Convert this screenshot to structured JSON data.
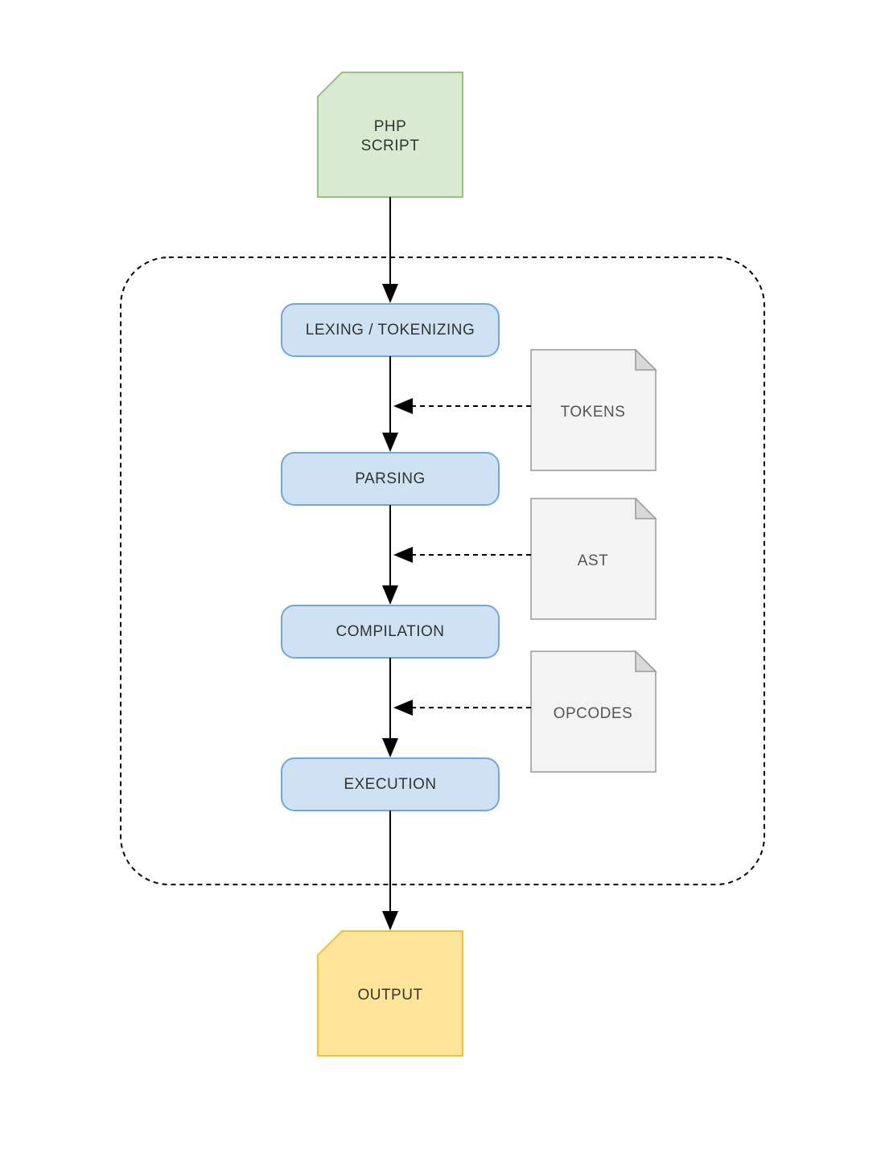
{
  "input": {
    "line1": "PHP",
    "line2": "SCRIPT"
  },
  "stages": {
    "lexing": "LEXING / TOKENIZING",
    "parsing": "PARSING",
    "compilation": "COMPILATION",
    "execution": "EXECUTION"
  },
  "artifacts": {
    "tokens": "TOKENS",
    "ast": "AST",
    "opcodes": "OPCODES"
  },
  "output": {
    "label": "OUTPUT"
  },
  "colors": {
    "input_fill": "#d9ead3",
    "input_stroke": "#93c47d",
    "stage_fill": "#cfe2f3",
    "stage_stroke": "#6fa8dc",
    "doc_fill": "#f3f3f3",
    "doc_stroke": "#999999",
    "output_fill": "#ffe599",
    "output_stroke": "#f1c232"
  }
}
